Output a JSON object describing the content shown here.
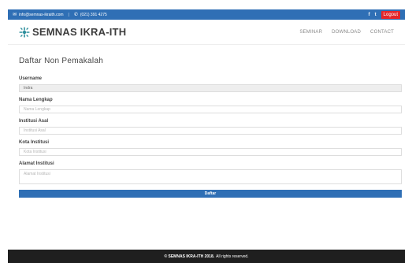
{
  "topbar": {
    "email": "info@semnas-ikraith.com",
    "phone": "(021) 391 4275",
    "social_facebook": "f",
    "social_twitter": "t",
    "logout_label": "Logout"
  },
  "header": {
    "brand": "SEMNAS IKRA-ITH",
    "nav": [
      "SEMINAR",
      "DOWNLOAD",
      "CONTACT"
    ]
  },
  "form": {
    "title": "Daftar Non Pemakalah",
    "username": {
      "label": "Username",
      "value": "Indra"
    },
    "nama_lengkap": {
      "label": "Nama Lengkap",
      "placeholder": "Nama Lengkap"
    },
    "institusi_asal": {
      "label": "Institusi Asal",
      "placeholder": "Institusi Asal"
    },
    "kota_institusi": {
      "label": "Kota Institusi",
      "placeholder": "Kota Institusi"
    },
    "alamat_institusi": {
      "label": "Alamat Institusi",
      "placeholder": "Alamat Institusi"
    },
    "submit_label": "Daftar"
  },
  "footer": {
    "brand": "© SEMNAS IKRA-ITH 2018.",
    "text": "All rights reserved."
  },
  "colors": {
    "primary": "#2f6fb5",
    "logout": "#e3262b",
    "footer_bg": "#1f1f1f"
  }
}
